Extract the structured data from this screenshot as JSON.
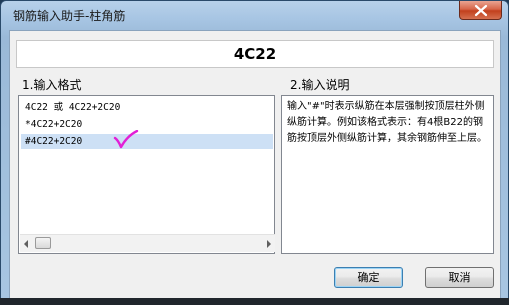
{
  "window": {
    "title": "钢筋输入助手-柱角筋",
    "close_icon": "close-icon"
  },
  "header": {
    "value": "4C22"
  },
  "format_section": {
    "label": "1.输入格式",
    "items": [
      {
        "text": "4C22 或 4C22+2C20",
        "selected": false
      },
      {
        "text": "*4C22+2C20",
        "selected": false
      },
      {
        "text": "#4C22+2C20",
        "selected": true
      }
    ]
  },
  "description_section": {
    "label": "2.输入说明",
    "text": "输入\"#\"时表示纵筋在本层强制按顶层柱外侧纵筋计算。例如该格式表示：有4根B22的钢筋按顶层外侧纵筋计算，其余钢筋伸至上层。"
  },
  "buttons": {
    "confirm": "确定",
    "cancel": "取消"
  },
  "colors": {
    "selection": "#cde0f5",
    "annotation_check": "#e21fd6",
    "titlebar": "#a7c5e3"
  }
}
